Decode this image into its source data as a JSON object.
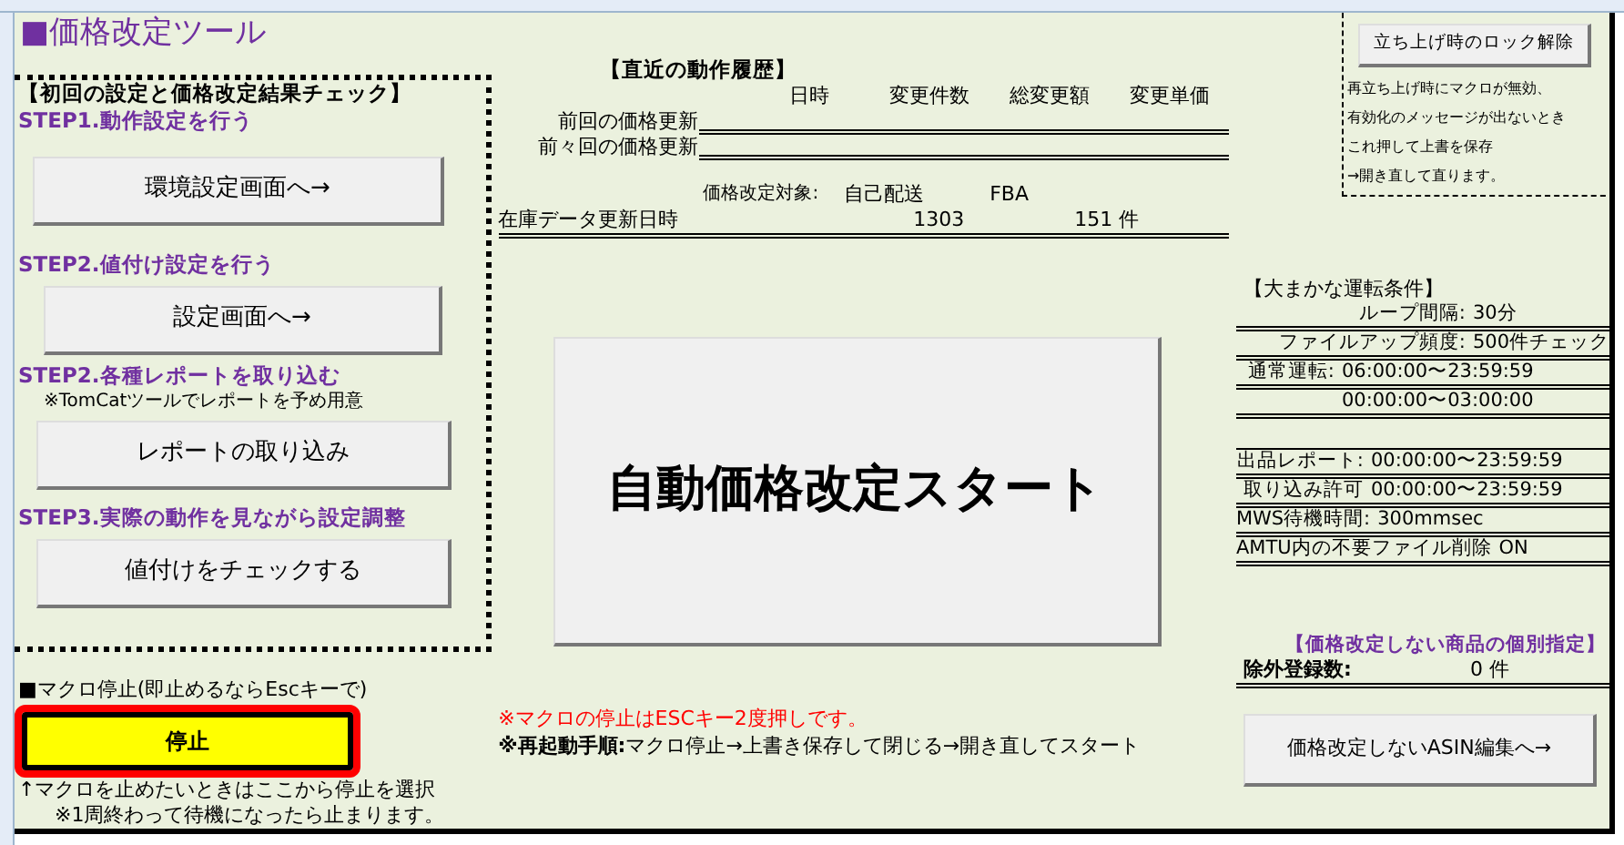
{
  "title": "■価格改定ツール",
  "setup": {
    "heading": "【初回の設定と価格改定結果チェック】",
    "steps": [
      {
        "label": "STEP1.動作設定を行う",
        "button": "環境設定画面へ→"
      },
      {
        "label": "STEP2.値付け設定を行う",
        "button": "設定画面へ→"
      },
      {
        "label": "STEP2.各種レポートを取り込む",
        "note": "※TomCatツールでレポートを予め用意",
        "button": "レポートの取り込み"
      },
      {
        "label": "STEP3.実際の動作を見ながら設定調整",
        "button": "値付けをチェックする"
      }
    ]
  },
  "stop": {
    "heading": "■マクロ停止(即止めるならEscキーで)",
    "button": "停止",
    "notes": [
      "↑マクロを止めたいときはここから停止を選択",
      "※1周終わって待機になったら止まります。"
    ]
  },
  "history": {
    "heading": "【直近の動作履歴】",
    "columns": [
      "日時",
      "変更件数",
      "総変更額",
      "変更単価"
    ],
    "rows": [
      {
        "label": "前回の価格更新"
      },
      {
        "label": "前々回の価格更新"
      }
    ]
  },
  "inventory": {
    "target_label": "価格改定対象:",
    "columns": [
      "自己配送",
      "FBA"
    ],
    "label": "在庫データ更新日時",
    "values": [
      "1303",
      "151 件"
    ]
  },
  "start_button": "自動価格改定スタート",
  "notes": [
    {
      "kind": "warning",
      "text": "※マクロの停止はESCキー2度押しです。"
    },
    {
      "kind": "info",
      "text": "**※再起動手順:**マクロ停止→上書き保存して閉じる→開き直してスタート"
    }
  ],
  "lock": {
    "button": "立ち上げ時のロック解除",
    "lines": [
      "再立ち上げ時にマクロが無効、",
      "有効化のメッセージが出ないとき",
      "これ押して上書を保存",
      "→開き直して直ります。"
    ]
  },
  "conditions": {
    "heading": "【大まかな運転条件】",
    "groups": [
      [
        {
          "label": "ループ間隔:",
          "value": "30分"
        },
        {
          "label": "ファイルアップ頻度:",
          "value": "500件チェック"
        },
        {
          "label": "通常運転:",
          "value": "06:00:00〜23:59:59"
        },
        {
          "value": "00:00:00〜03:00:00"
        }
      ],
      [
        {
          "label": "出品レポート:",
          "value": "00:00:00〜23:59:59"
        },
        {
          "label": "取り込み許可",
          "value": "00:00:00〜23:59:59"
        },
        {
          "label": "MWS待機時間:",
          "value": "300mmsec"
        },
        {
          "label": "AMTU内の不要ファイル削除",
          "value": "ON"
        }
      ]
    ]
  },
  "exclusion": {
    "heading": "【価格改定しない商品の個別指定】",
    "label": "除外登録数:",
    "value": "0 件",
    "button": "価格改定しないASIN編集へ→"
  }
}
